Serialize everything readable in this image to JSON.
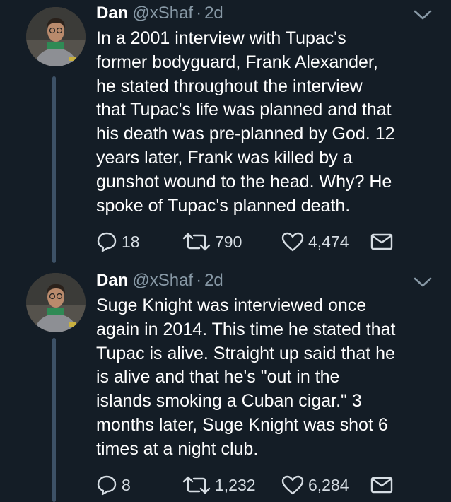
{
  "tweets": [
    {
      "name": "Dan",
      "handle": "@xShaf",
      "dot": "·",
      "time": "2d",
      "text": "In a 2001 interview with Tupac's\nformer bodyguard, Frank Alexander,\nhe stated throughout the interview\nthat Tupac's life was planned and that\nhis death was pre-planned by God. 12\nyears later, Frank was killed by a\ngunshot wound to the head. Why? He\nspoke of Tupac's planned death.",
      "replies": "18",
      "retweets": "790",
      "likes": "4,474"
    },
    {
      "name": "Dan",
      "handle": "@xShaf",
      "dot": "·",
      "time": "2d",
      "text": "Suge Knight was interviewed once\nagain in 2014. This time he stated that\nTupac is alive. Straight up said that he\nis alive and that he's \"out in the\nislands smoking a Cuban cigar.\" 3\nmonths later, Suge Knight was shot 6\ntimes at a night club.",
      "replies": "8",
      "retweets": "1,232",
      "likes": "6,284"
    }
  ],
  "icons": {
    "reply": "reply-icon",
    "retweet": "retweet-icon",
    "like": "heart-icon",
    "message": "envelope-icon",
    "menu": "chevron-down-icon"
  },
  "colors": {
    "background": "#141d26",
    "secondary_text": "#8899a6",
    "thread_line": "#3d5166"
  }
}
